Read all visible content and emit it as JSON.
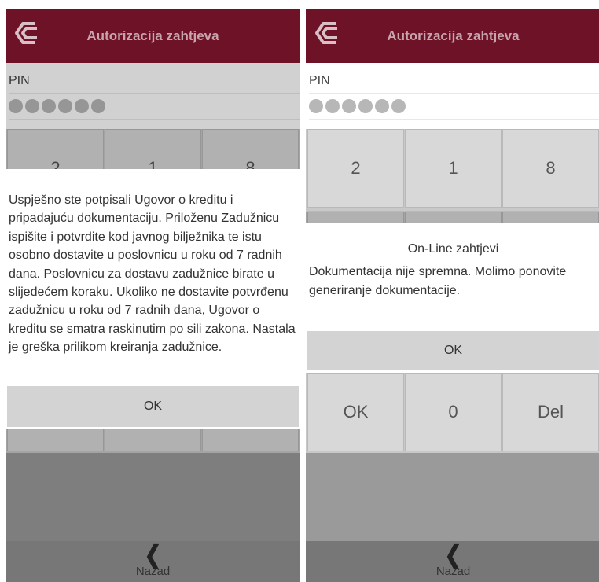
{
  "header": {
    "title": "Autorizacija zahtjeva"
  },
  "pin": {
    "label": "PIN",
    "dots": 6
  },
  "keypad": {
    "row1": [
      "2",
      "1",
      "8"
    ],
    "row4": [
      "OK",
      "0",
      "Del"
    ]
  },
  "footer": {
    "back_label": "Nazad"
  },
  "dialog_left": {
    "message": "Uspješno ste potpisali Ugovor o kreditu i pripadajuću dokumentaciju. Priloženu Zadužnicu ispišite i potvrdite kod javnog bilježnika te istu osobno dostavite u poslovnicu u roku od 7 radnih dana. Poslovnicu za dostavu zadužnice birate u slijedećem koraku. Ukoliko ne dostavite potvrđenu zadužnicu u roku od 7 radnih dana, Ugovor o kreditu se smatra raskinutim po sili zakona. Nastala je greška prilikom kreiranja zadužnice.",
    "ok_label": "OK"
  },
  "dialog_right": {
    "title": "On-Line zahtjevi",
    "message": "Dokumentacija nije spremna. Molimo ponovite generiranje dokumentacije.",
    "ok_label": "OK"
  },
  "colors": {
    "header_bg": "#6e1228",
    "header_text": "#c9a4ad",
    "footer_bg": "#777777"
  },
  "icons": {
    "logo": "bank-logo-icon",
    "back": "chevron-left-icon"
  }
}
